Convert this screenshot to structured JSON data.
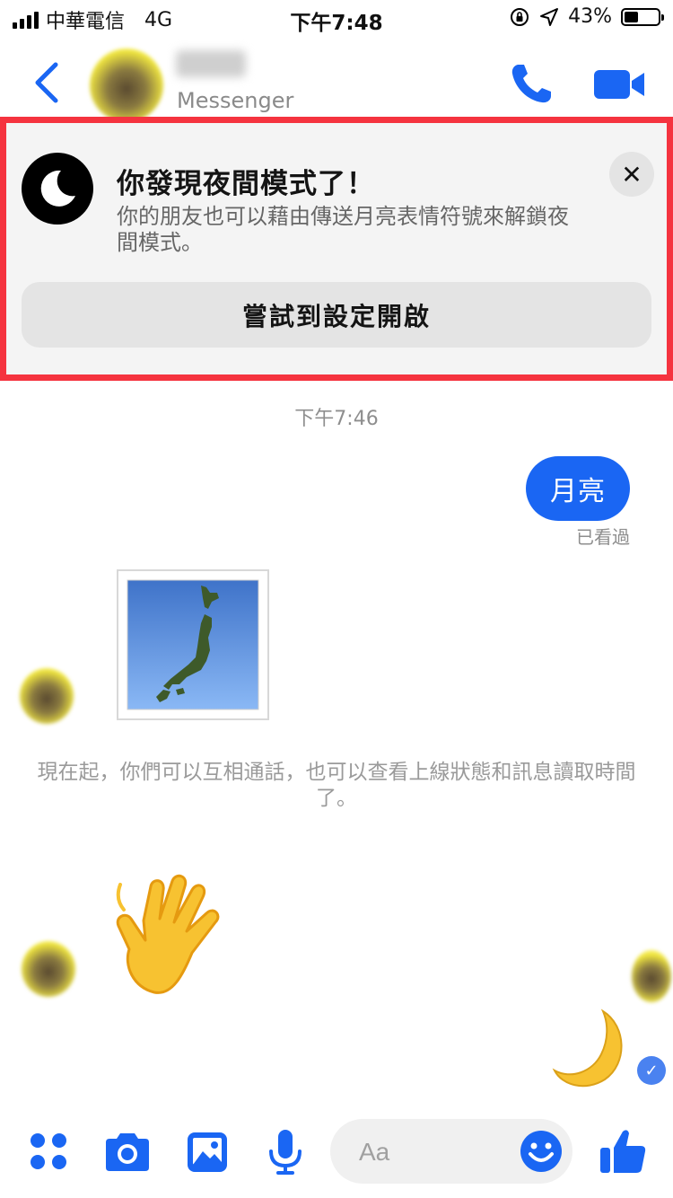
{
  "status_bar": {
    "carrier": "中華電信",
    "network": "4G",
    "time": "下午7:48",
    "battery": "43%",
    "battery_level": 0.43
  },
  "header": {
    "subtitle": "Messenger",
    "icons": [
      "back-icon",
      "phone-icon",
      "video-icon"
    ]
  },
  "banner": {
    "title": "你發現夜間模式了！",
    "description": "你的朋友也可以藉由傳送月亮表情符號來解鎖夜間模式。",
    "close_label": "✕",
    "button_label": "嘗試到設定開啟",
    "icon": "moon-icon"
  },
  "chat": {
    "timestamp": "下午7:46",
    "outgoing_message": "月亮",
    "seen_label": "已看過",
    "sticker": "japan-map-sticker",
    "notice": "現在起，你們可以互相通話，也可以查看上線狀態和訊息讀取時間了。",
    "reactions": [
      "waving-hand-emoji",
      "crescent-moon-emoji"
    ]
  },
  "composer": {
    "placeholder": "Aa",
    "icons": [
      "apps-icon",
      "camera-icon",
      "gallery-icon",
      "microphone-icon",
      "emoji-icon",
      "thumbs-up-icon"
    ]
  },
  "colors": {
    "accent": "#1a66f3",
    "banner_border": "#f5333f",
    "banner_bg": "#f4f4f4"
  }
}
